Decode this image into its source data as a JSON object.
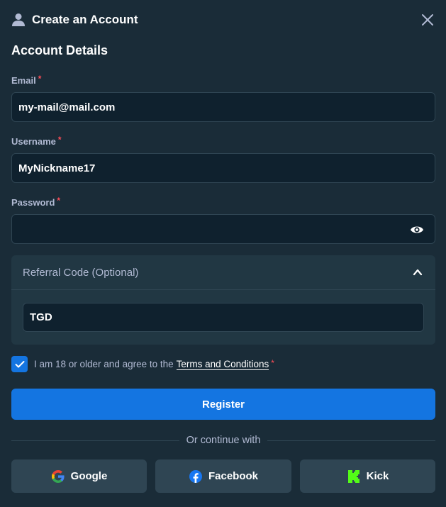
{
  "header": {
    "title": "Create an Account"
  },
  "section": {
    "title": "Account Details"
  },
  "form": {
    "email": {
      "label": "Email",
      "value": "my-mail@mail.com",
      "required_mark": "*"
    },
    "username": {
      "label": "Username",
      "value": "MyNickname17",
      "required_mark": "*"
    },
    "password": {
      "label": "Password",
      "value": "",
      "required_mark": "*"
    }
  },
  "referral": {
    "label": "Referral Code (Optional)",
    "value": "TGD",
    "expanded": true
  },
  "terms": {
    "text": "I am 18 or older and agree to the",
    "link": "Terms and Conditions",
    "required_mark": "*",
    "checked": true
  },
  "register": {
    "label": "Register"
  },
  "divider": {
    "text": "Or continue with"
  },
  "social": [
    {
      "label": "Google",
      "icon": "google-icon"
    },
    {
      "label": "Facebook",
      "icon": "facebook-icon"
    },
    {
      "label": "Kick",
      "icon": "kick-icon"
    }
  ],
  "colors": {
    "background": "#1a2c38",
    "input_bg": "#0f212e",
    "accent": "#1475e1",
    "required": "#ff4d57",
    "muted_text": "#b1bad3",
    "social_bg": "#2f4553"
  }
}
